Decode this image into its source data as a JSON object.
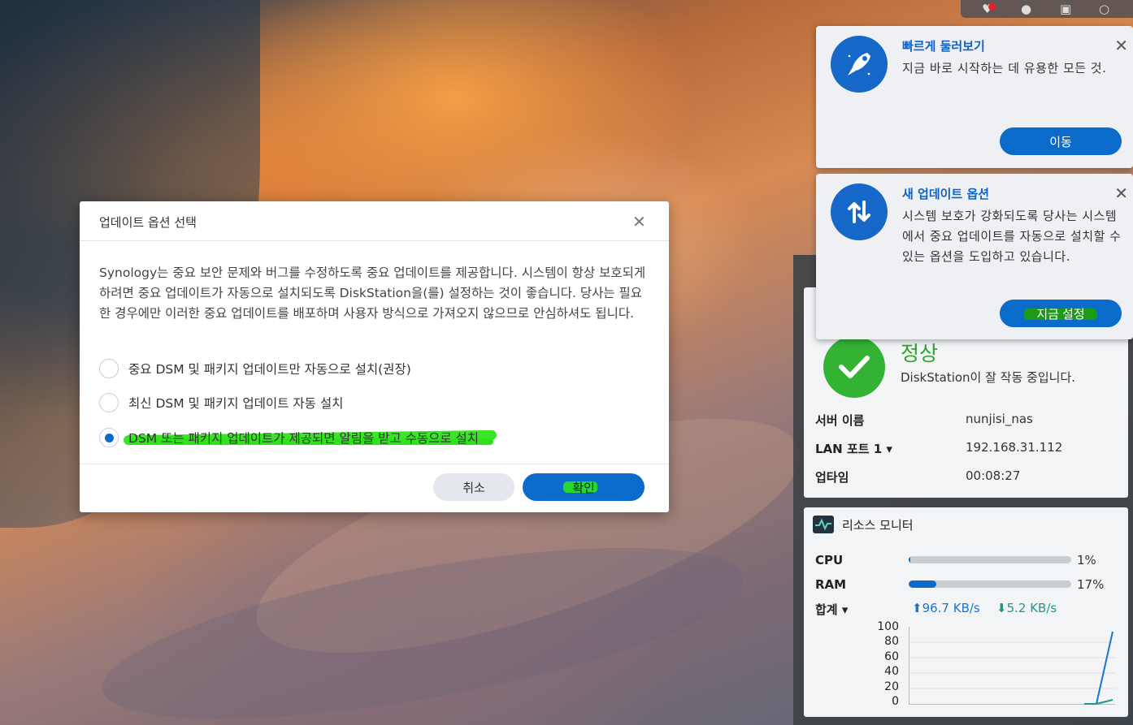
{
  "notifications": [
    {
      "title": "빠르게 둘러보기",
      "body": "지금 바로 시작하는 데 유용한 모든 것.",
      "button": "이동",
      "icon": "rocket-icon"
    },
    {
      "title": "새 업데이트 옵션",
      "body": "시스템 보호가 강화되도록 당사는 시스템에서 중요 업데이트를 자동으로 설치할 수 있는 옵션을 도입하고 있습니다.",
      "button": "지금 설정",
      "icon": "update-arrows-icon"
    }
  ],
  "dialog": {
    "title": "업데이트 옵션 선택",
    "description": "Synology는 중요 보안 문제와 버그를 수정하도록 중요 업데이트를 제공합니다. 시스템이 항상 보호되게 하려면 중요 업데이트가 자동으로 설치되도록 DiskStation을(를) 설정하는 것이 좋습니다. 당사는 필요한 경우에만 이러한 중요 업데이트를 배포하며 사용자 방식으로 가져오지 않으므로 안심하셔도 됩니다.",
    "options": [
      {
        "label": "중요 DSM 및 패키지 업데이트만 자동으로 설치(권장)",
        "selected": false
      },
      {
        "label": "최신 DSM 및 패키지 업데이트 자동 설치",
        "selected": false
      },
      {
        "label": "DSM 또는 패키지 업데이트가 제공되면 알림을 받고 수동으로 설치",
        "selected": true
      }
    ],
    "cancel": "취소",
    "ok": "확인"
  },
  "system_health": {
    "status": "정상",
    "description": "DiskStation이 잘 작동 중입니다.",
    "rows": [
      {
        "label": "서버 이름",
        "value": "nunjisi_nas"
      },
      {
        "label": "LAN 포트 1 ▾",
        "value": "192.168.31.112"
      },
      {
        "label": "업타임",
        "value": "00:08:27"
      }
    ]
  },
  "resource_monitor": {
    "title": "리소스 모니터",
    "cpu_label": "CPU",
    "cpu_value": "1%",
    "cpu_fraction": 0.01,
    "ram_label": "RAM",
    "ram_value": "17%",
    "ram_fraction": 0.17,
    "net_label": "합계 ▾",
    "upload": "96.7 KB/s",
    "download": "5.2 KB/s",
    "y_ticks": [
      "100",
      "80",
      "60",
      "40",
      "20",
      "0"
    ]
  },
  "colors": {
    "accent": "#0b6bca",
    "healthy": "#33b233",
    "highlight": "#2fe31b"
  }
}
